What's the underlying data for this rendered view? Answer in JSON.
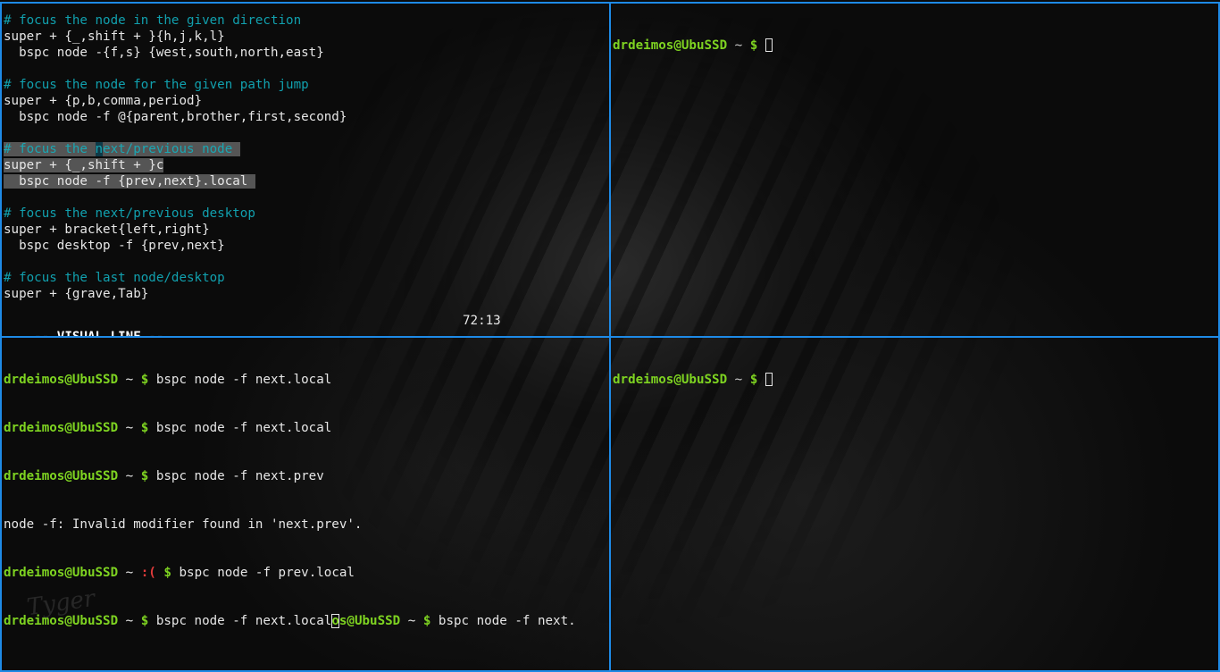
{
  "prompt": {
    "user": "drdeimos@UbuSSD",
    "cwd": "~",
    "symbol": "$",
    "sad": ":("
  },
  "config_lines": [
    {
      "type": "comment",
      "text": "# focus the node in the given direction"
    },
    {
      "type": "code",
      "text": "super + {_,shift + }{h,j,k,l}"
    },
    {
      "type": "code",
      "text": "  bspc node -{f,s} {west,south,north,east}"
    },
    {
      "type": "blank",
      "text": ""
    },
    {
      "type": "comment",
      "text": "# focus the node for the given path jump"
    },
    {
      "type": "code",
      "text": "super + {p,b,comma,period}"
    },
    {
      "type": "code",
      "text": "  bspc node -f @{parent,brother,first,second}"
    },
    {
      "type": "blank",
      "text": ""
    },
    {
      "type": "comment_hl",
      "text_before": "# focus the ",
      "cursor_char": "n",
      "text_after": "ext/previous node "
    },
    {
      "type": "code_hl",
      "text": "super + {_,shift + }c"
    },
    {
      "type": "code_hl",
      "text": "  bspc node -f {prev,next}.local "
    },
    {
      "type": "blank",
      "text": ""
    },
    {
      "type": "comment",
      "text": "# focus the next/previous desktop"
    },
    {
      "type": "code",
      "text": "super + bracket{left,right}"
    },
    {
      "type": "code",
      "text": "  bspc desktop -f {prev,next}"
    },
    {
      "type": "blank",
      "text": ""
    },
    {
      "type": "comment",
      "text": "# focus the last node/desktop"
    },
    {
      "type": "code",
      "text": "super + {grave,Tab}"
    }
  ],
  "statusline": {
    "mode": "-- VISUAL LINE --",
    "position": "72:13"
  },
  "terminal_bl": {
    "cmd1": " bspc node -f next.local",
    "cmd2": " bspc node -f next.local",
    "cmd3": " bspc node -f next.prev",
    "error": "node -f: Invalid modifier found in 'next.prev'.",
    "cmd4": " bspc node -f prev.local",
    "cmd5": " bspc node -f next.local",
    "cursor_char": "o",
    "overlap_user": "s@UbuSSD",
    "cmd6": " bspc node -f next."
  },
  "signature": "Tyger"
}
